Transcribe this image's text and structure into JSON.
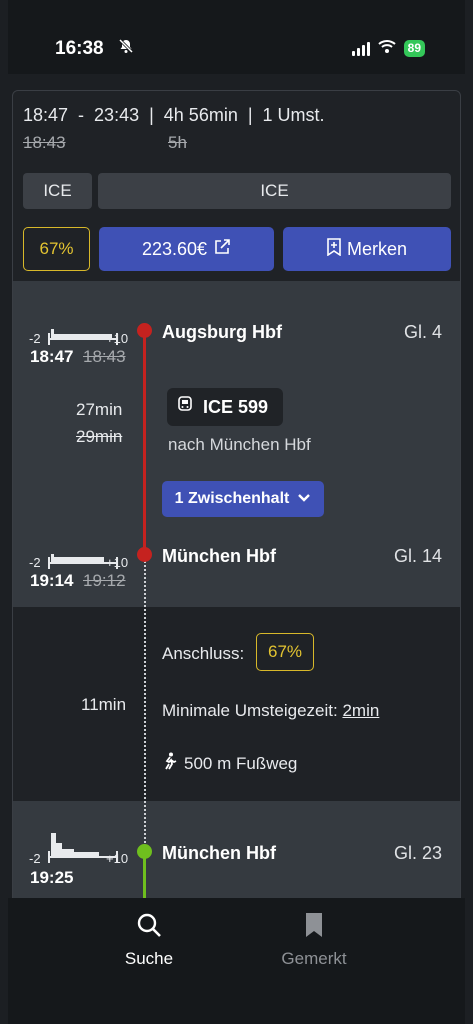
{
  "status": {
    "time": "16:38",
    "battery": "89"
  },
  "summary": {
    "dep": "18:47",
    "arr": "23:43",
    "duration": "4h 56min",
    "transfers": "1 Umst.",
    "old_dep": "18:43",
    "old_duration": "5h",
    "chips": [
      "ICE",
      "ICE"
    ],
    "probability": "67%",
    "price": "223.60€",
    "bookmark": "Merken"
  },
  "leg1": {
    "origin": {
      "name": "Augsburg Hbf",
      "platform": "Gl. 4",
      "time": "18:47",
      "old_time": "18:43",
      "hist_left": "-2",
      "hist_right": "+10"
    },
    "train": "ICE 599",
    "direction": "nach München Hbf",
    "duration": "27min",
    "old_duration": "29min",
    "stops": "1 Zwischenhalt",
    "dest": {
      "name": "München Hbf",
      "platform": "Gl. 14",
      "time": "19:14",
      "old_time": "19:12",
      "hist_left": "-2",
      "hist_right": "+10"
    }
  },
  "transfer": {
    "label": "Anschluss:",
    "probability": "67%",
    "duration": "11min",
    "min_label": "Minimale Umsteigezeit:",
    "min_value": "2min",
    "walk": "500 m Fußweg"
  },
  "leg2": {
    "origin": {
      "name": "München Hbf",
      "platform": "Gl. 23",
      "time": "19:25",
      "hist_left": "-2",
      "hist_right": "+10"
    }
  },
  "tabs": [
    {
      "label": "Suche",
      "icon": "search-icon",
      "active": true
    },
    {
      "label": "Gemerkt",
      "icon": "bookmark-icon",
      "active": false
    }
  ],
  "colors": {
    "accent": "#3f51b5",
    "warning": "#e3c431",
    "red": "#c5221f",
    "green": "#6fbf1e"
  }
}
